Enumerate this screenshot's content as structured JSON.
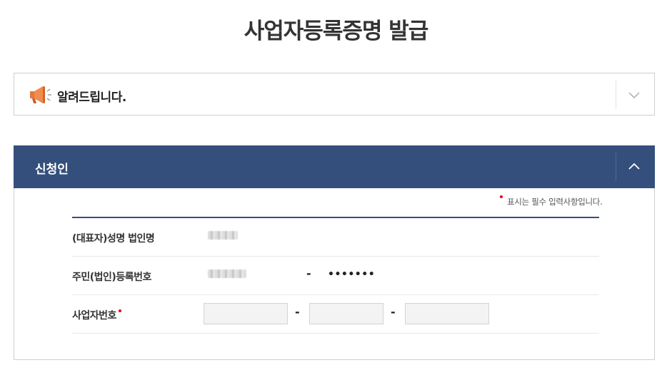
{
  "page": {
    "title": "사업자등록증명 발급"
  },
  "notice": {
    "label": "알려드립니다."
  },
  "applicant": {
    "section_title": "신청인",
    "required_note": "표시는 필수 입력사항입니다.",
    "rows": [
      {
        "label": "(대표자)성명 법인명"
      },
      {
        "label": "주민(법인)등록번호",
        "masked_suffix": "•••••••"
      },
      {
        "label": "사업자번호"
      }
    ],
    "business_number": {
      "part1": "",
      "part2": "",
      "part3": ""
    },
    "separator": "-"
  },
  "colors": {
    "header_bg": "#344f7b",
    "required_dot": "#e60012",
    "icon_orange": "#e8753a"
  },
  "icons": [
    "megaphone-icon",
    "chevron-down-icon",
    "chevron-up-icon"
  ]
}
